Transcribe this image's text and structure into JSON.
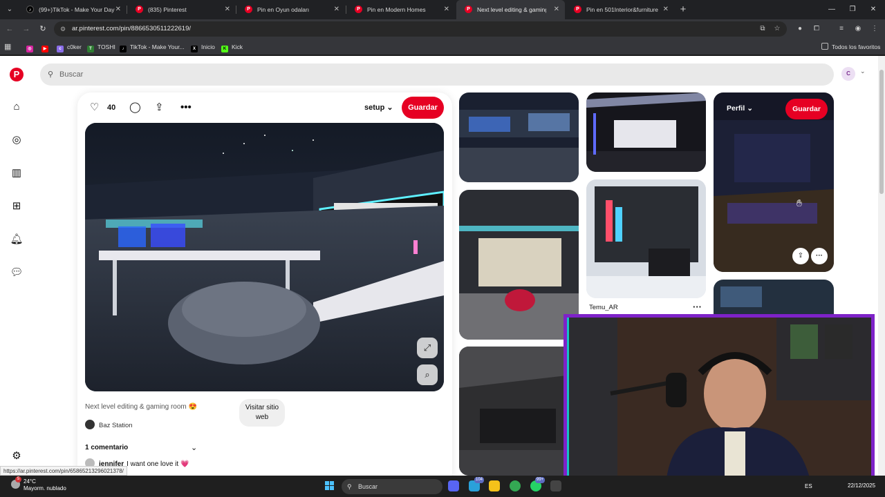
{
  "browser": {
    "tabs": [
      {
        "icon": "tiktok-icon",
        "label": "(99+)TikTok - Make Your Day",
        "active": false
      },
      {
        "icon": "pinterest-icon",
        "label": "(835) Pinterest",
        "active": false
      },
      {
        "icon": "pinterest-icon",
        "label": "Pin en Oyun odaları",
        "active": false
      },
      {
        "icon": "pinterest-icon",
        "label": "Pin en Modern Homes",
        "active": false
      },
      {
        "icon": "pinterest-icon",
        "label": "Next level editing & gaming ro",
        "active": true
      },
      {
        "icon": "pinterest-icon",
        "label": "Pin en 501Interior&furniture",
        "active": false
      }
    ],
    "url": "ar.pinterest.com/pin/8866530511222619/",
    "bookmarks": [
      {
        "label": "",
        "icon": "instagram-icon",
        "color": "#d6249f"
      },
      {
        "label": "",
        "icon": "youtube-icon",
        "color": "#ff0000"
      },
      {
        "label": "c0ker",
        "icon": "c0ker-icon",
        "color": "#8a6de9"
      },
      {
        "label": "TOSHI",
        "icon": "toshi-icon",
        "color": "#2e7d32"
      },
      {
        "label": "TikTok - Make Your...",
        "icon": "tiktok-icon",
        "color": "#000000"
      },
      {
        "label": "Inicio",
        "icon": "x-icon",
        "color": "#000000"
      },
      {
        "label": "Kick",
        "icon": "kick-icon",
        "color": "#53fc18"
      }
    ],
    "all_bookmarks": "Todos los favoritos"
  },
  "pinterest": {
    "search_placeholder": "Buscar",
    "avatar_letter": "C",
    "pin": {
      "likes": "40",
      "board": "setup",
      "save_label": "Guardar",
      "title": "Next level editing & gaming room 😍",
      "visit_label": "Visitar sitio web",
      "author": "Baz Station",
      "comments_label": "1 comentario",
      "comment_user": "jennifer",
      "comment_text": "I want one love it",
      "comment_heart": "💗"
    },
    "grid": {
      "tile_user": "Temu_AR",
      "hover_board": "Perfil",
      "hover_save": "Guardar"
    }
  },
  "status_url": "https://ar.pinterest.com/pin/65865213296021378/",
  "taskbar": {
    "temperature": "24°C",
    "weather": "Mayorm. nublado",
    "weather_badge": "5",
    "search_placeholder": "Buscar",
    "badge_1": "104",
    "badge_2": "99+",
    "lang": "ES",
    "date": "22/12/2025"
  },
  "colors": {
    "pinterest_red": "#e60023",
    "webcam_border": "#7e22c8",
    "webcam_accent": "#15c4c4"
  }
}
